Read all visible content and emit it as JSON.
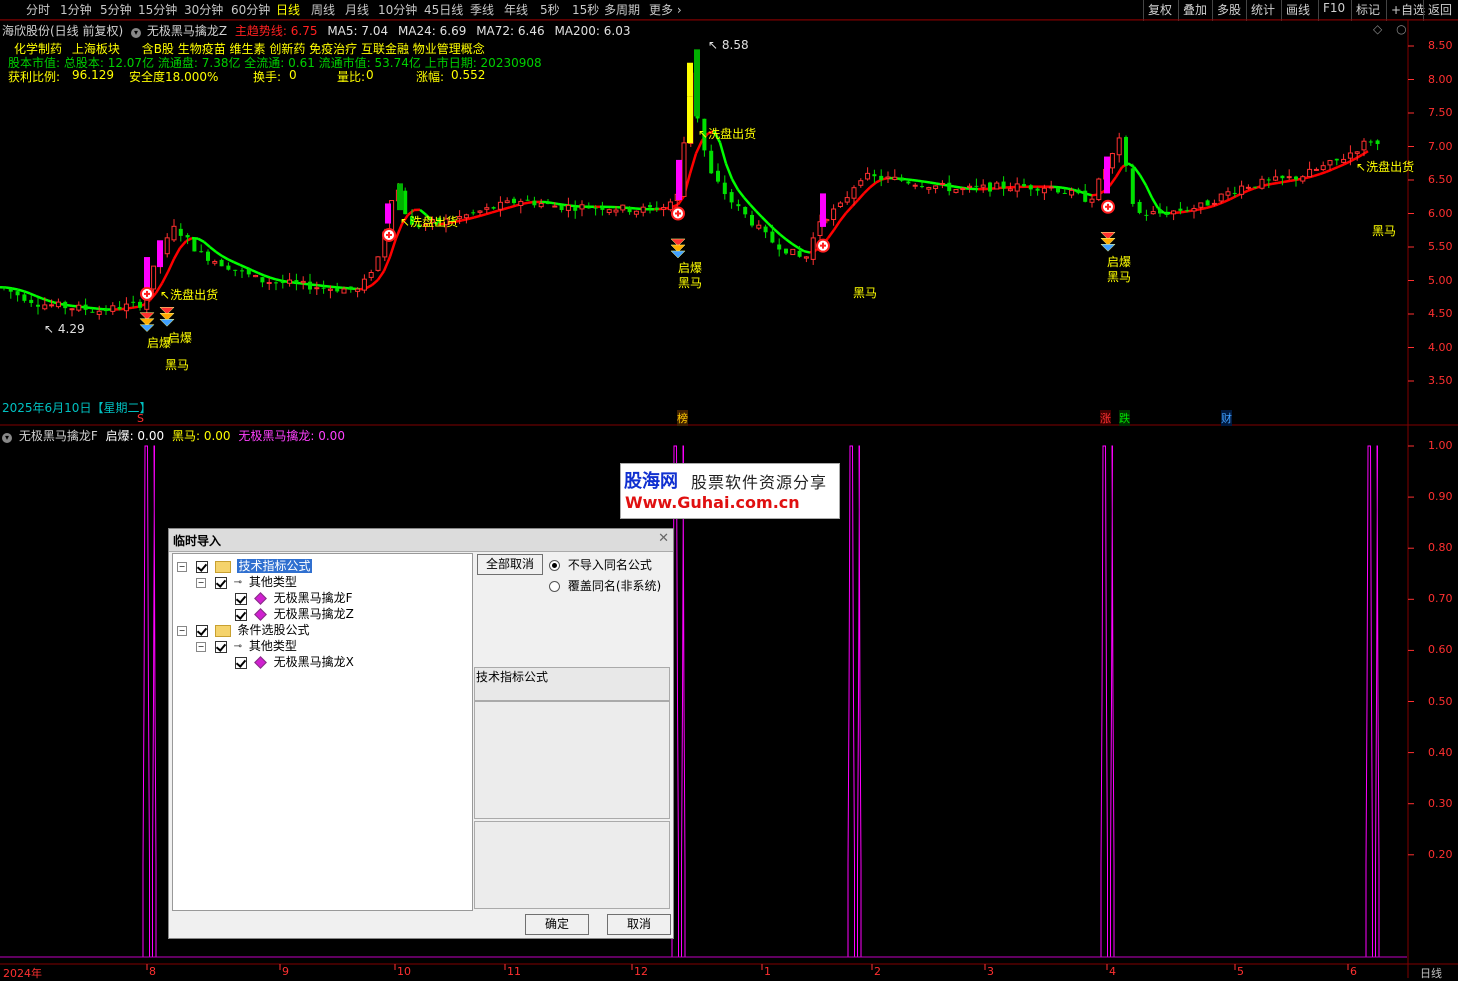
{
  "toolbar": {
    "periods": [
      "分时",
      "1分钟",
      "5分钟",
      "15分钟",
      "30分钟",
      "60分钟",
      "日线",
      "周线",
      "月线",
      "10分钟",
      "45日线",
      "季线",
      "年线",
      "5秒",
      "15秒",
      "多周期",
      "更多"
    ],
    "active": "日线",
    "right_buttons": [
      "复权",
      "叠加",
      "多股",
      "统计",
      "画线",
      "F10",
      "标记",
      "+自选",
      "返回"
    ]
  },
  "main_header": {
    "stock": "海欣股份(日线 前复权)",
    "indicator": "无极黑马擒龙Z",
    "trend_label": "主趋势线:",
    "trend_value": "6.75",
    "ma5": "MA5: 7.04",
    "ma24": "MA24: 6.69",
    "ma72": "MA72: 6.46",
    "ma200": "MA200: 6.03"
  },
  "info": {
    "line1": [
      "化学制药",
      "上海板块",
      "含B股 生物疫苗 维生素 创新药 免疫治疗 互联金融 物业管理概念"
    ],
    "line2": "股本市值: 总股本: 12.07亿 流通盘: 7.38亿 全流通: 0.61 流通市值: 53.74亿 上市日期: 20230908",
    "line3": [
      {
        "label": "获利比例:",
        "value": "96.129"
      },
      {
        "label": "安全度18.000%",
        "value": ""
      },
      {
        "label": "换手:",
        "value": "0"
      },
      {
        "label": "量比:",
        "value": "0"
      },
      {
        "label": "涨幅:",
        "value": "0.552"
      }
    ]
  },
  "price_axis": [
    "8.50",
    "8.00",
    "7.50",
    "7.00",
    "6.50",
    "6.00",
    "5.50",
    "5.00",
    "4.50",
    "4.00",
    "3.50"
  ],
  "annotations": {
    "high": "8.58",
    "low": "4.29",
    "date": "2025年6月10日【星期二】",
    "wash": "洗盘出货",
    "qibao": "启爆",
    "heima": "黑马",
    "markers": [
      "S",
      "榜",
      "涨",
      "跌",
      "财"
    ]
  },
  "sub_header": {
    "name": "无极黑马擒龙F",
    "qibao": "启爆: 0.00",
    "heima": "黑马: 0.00",
    "qinlong": "无极黑马擒龙: 0.00"
  },
  "sub_axis": [
    "1.00",
    "0.90",
    "0.80",
    "0.70",
    "0.60",
    "0.50",
    "0.40",
    "0.30",
    "0.20"
  ],
  "time_axis": {
    "year": "2024年",
    "months": [
      "8",
      "9",
      "10",
      "11",
      "12",
      "1",
      "2",
      "3",
      "4",
      "5",
      "6"
    ],
    "period": "日线"
  },
  "watermark": {
    "brand": "股海网",
    "slogan": "股票软件资源分享",
    "url": "Www.Guhai.com.cn"
  },
  "dialog": {
    "title": "临时导入",
    "tree": [
      {
        "level": 0,
        "type": "folder",
        "label": "技术指标公式",
        "selected": true
      },
      {
        "level": 1,
        "type": "key",
        "label": "其他类型"
      },
      {
        "level": 2,
        "type": "formula",
        "label": "无极黑马擒龙F"
      },
      {
        "level": 2,
        "type": "formula",
        "label": "无极黑马擒龙Z"
      },
      {
        "level": 0,
        "type": "folder",
        "label": "条件选股公式"
      },
      {
        "level": 1,
        "type": "key",
        "label": "其他类型"
      },
      {
        "level": 2,
        "type": "formula",
        "label": "无极黑马擒龙X"
      }
    ],
    "cancel_all": "全部取消",
    "option_no_import": "不导入同名公式",
    "option_overwrite": "覆盖同名(非系统)",
    "desc": "技术指标公式",
    "ok": "确定",
    "cancel": "取消"
  },
  "colors": {
    "up": "#ff3030",
    "down": "#00e000",
    "trend_up": "#ff0000",
    "trend_down": "#00ff00",
    "magenta": "#ff00ff",
    "yellow": "#ffff00",
    "frame": "#800000"
  }
}
